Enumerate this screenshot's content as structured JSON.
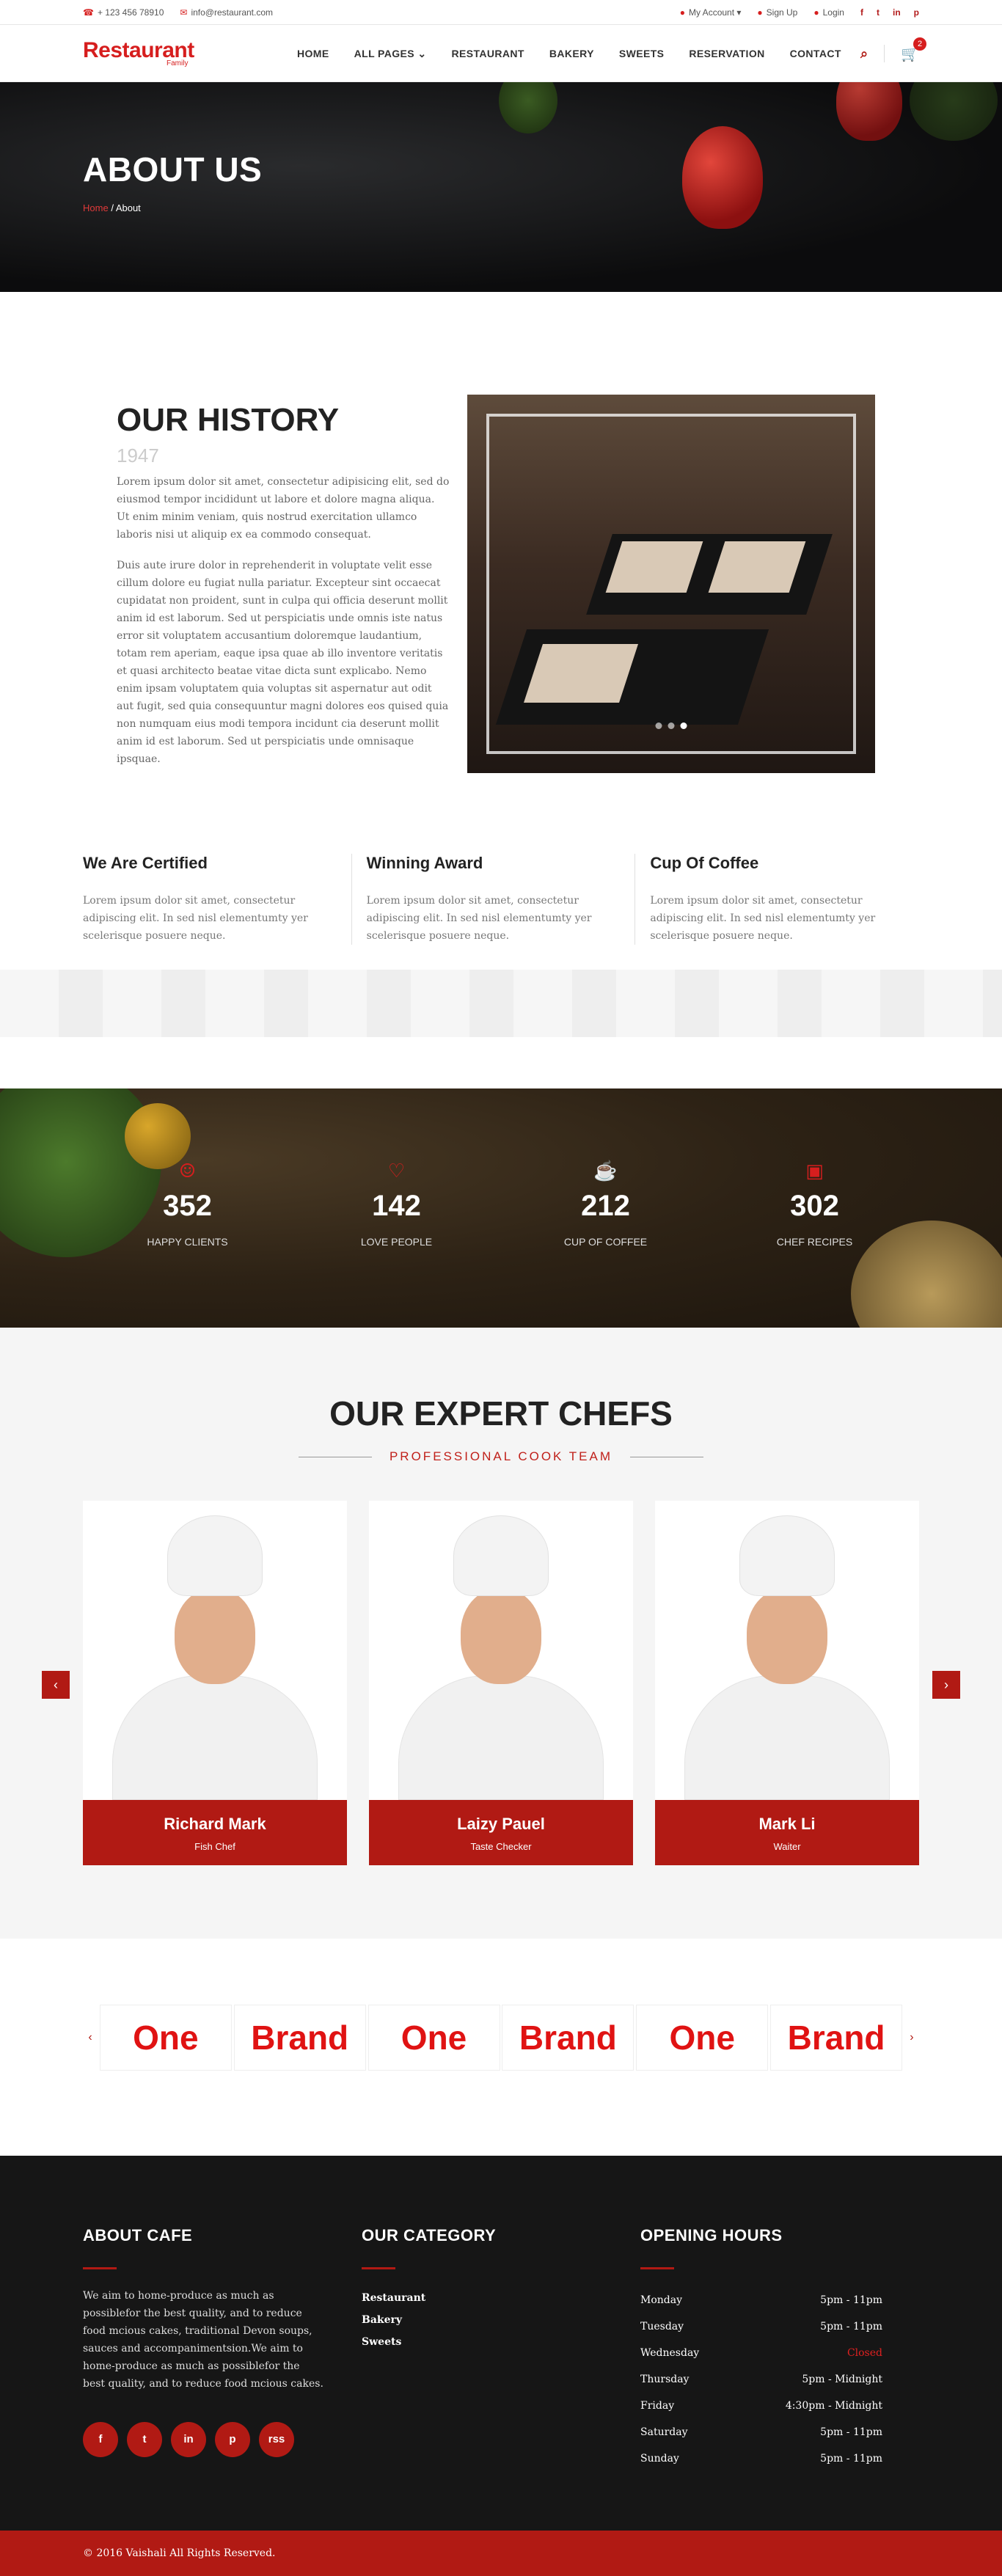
{
  "topbar": {
    "phone": "+ 123 456 78910",
    "email": "info@restaurant.com",
    "account": "My Account",
    "signup": "Sign Up",
    "login": "Login",
    "social": [
      "f",
      "t",
      "in",
      "p"
    ]
  },
  "logo": {
    "main": "Restaurant",
    "sub": "Family"
  },
  "nav": {
    "items": [
      "HOME",
      "ALL PAGES",
      "RESTAURANT",
      "BAKERY",
      "SWEETS",
      "RESERVATION",
      "CONTACT"
    ],
    "cart_count": "2"
  },
  "banner": {
    "title": "ABOUT US",
    "crumb_home": "Home",
    "crumb_current": "/ About"
  },
  "history": {
    "title": "OUR HISTORY",
    "year": "1947",
    "p1": "Lorem ipsum dolor sit amet, consectetur adipisicing elit, sed do eiusmod tempor incididunt ut labore et dolore magna aliqua. Ut enim minim veniam, quis nostrud exercitation ullamco laboris nisi ut aliquip ex ea commodo consequat.",
    "p2": "Duis aute irure dolor in reprehenderit in voluptate velit esse cillum dolore eu fugiat nulla pariatur. Excepteur sint occaecat cupidatat non proident, sunt in culpa qui officia deserunt mollit anim id est laborum. Sed ut perspiciatis unde omnis iste natus error sit voluptatem accusantium doloremque laudantium, totam rem aperiam, eaque ipsa quae ab illo inventore veritatis et quasi architecto beatae vitae dicta sunt explicabo. Nemo enim ipsam voluptatem quia voluptas sit aspernatur aut odit aut fugit, sed quia consequuntur magni dolores eos quised quia non numquam eius modi tempora incidunt cia deserunt mollit anim id est laborum. Sed ut perspiciatis unde omnisaque ipsquae."
  },
  "features": [
    {
      "title": "We Are Certified",
      "text": "Lorem ipsum dolor sit amet, consectetur adipiscing elit. In sed nisl elementumty yer scelerisque posuere neque."
    },
    {
      "title": "Winning Award",
      "text": "Lorem ipsum dolor sit amet, consectetur adipiscing elit. In sed nisl elementumty yer scelerisque posuere neque."
    },
    {
      "title": "Cup Of Coffee",
      "text": "Lorem ipsum dolor sit amet, consectetur adipiscing elit. In sed nisl elementumty yer scelerisque posuere neque."
    }
  ],
  "counters": [
    {
      "icon": "smile-icon",
      "glyph": "☺",
      "value": "352",
      "label": "HAPPY CLIENTS"
    },
    {
      "icon": "heart-icon",
      "glyph": "♡",
      "value": "142",
      "label": "LOVE PEOPLE"
    },
    {
      "icon": "coffee-cup-icon",
      "glyph": "☕",
      "value": "212",
      "label": "CUP OF COFFEE"
    },
    {
      "icon": "book-icon",
      "glyph": "▣",
      "value": "302",
      "label": "CHEF RECIPES"
    }
  ],
  "chefs": {
    "title": "OUR EXPERT CHEFS",
    "subtitle": "PROFESSIONAL COOK TEAM",
    "items": [
      {
        "name": "Richard Mark",
        "role": "Fish Chef"
      },
      {
        "name": "Laizy Pauel",
        "role": "Taste Checker"
      },
      {
        "name": "Mark Li",
        "role": "Waiter"
      }
    ]
  },
  "brands": [
    "One",
    "Brand",
    "One",
    "Brand",
    "One",
    "Brand"
  ],
  "footer": {
    "about_title": "ABOUT CAFE",
    "about_text": "We aim to home-produce as much as possiblefor the best quality, and to reduce food mcious cakes, traditional Devon soups, sauces and accompanimentsion.We aim to home-produce as much as possiblefor the best quality, and to reduce food mcious cakes.",
    "cat_title": "OUR CATEGORY",
    "categories": [
      "Restaurant",
      "Bakery",
      "Sweets"
    ],
    "hours_title": "OPENING HOURS",
    "hours": [
      {
        "day": "Monday",
        "time": "5pm - 11pm"
      },
      {
        "day": "Tuesday",
        "time": "5pm - 11pm"
      },
      {
        "day": "Wednesday",
        "time": "Closed"
      },
      {
        "day": "Thursday",
        "time": "5pm - Midnight"
      },
      {
        "day": "Friday",
        "time": "4:30pm - Midnight"
      },
      {
        "day": "Saturday",
        "time": "5pm - 11pm"
      },
      {
        "day": "Sunday",
        "time": "5pm - 11pm"
      }
    ],
    "social": [
      "f",
      "t",
      "in",
      "p",
      "rss"
    ],
    "copyright": "© 2016 Vaishali All Rights Reserved."
  },
  "colors": {
    "accent": "#b11a14",
    "brand_red": "#e01313",
    "footer_bg": "#161616"
  }
}
